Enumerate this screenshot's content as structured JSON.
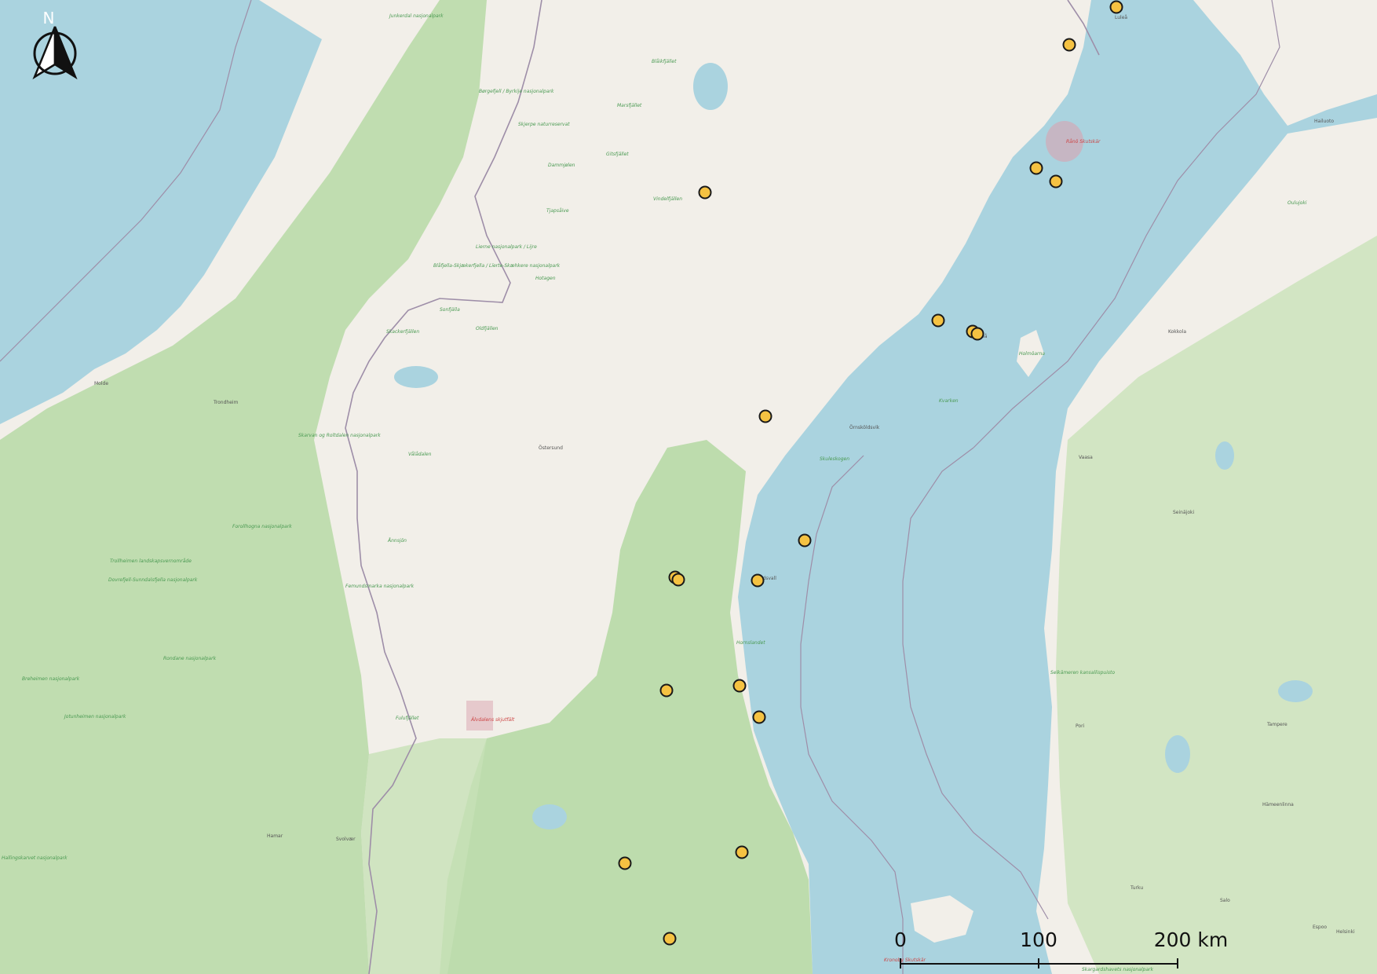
{
  "north_arrow": {
    "label": "N",
    "icon": "north-arrow-icon"
  },
  "scale_bar": {
    "ticks": [
      "0",
      "100",
      "200 km"
    ]
  },
  "colors": {
    "water": "#aad3df",
    "land": "#f2efe9",
    "park": "#b7d9a6",
    "marker": "#f5c242",
    "marker_stroke": "#1a1a1a",
    "border": "#9e8ea8"
  },
  "labels": {
    "parks": [
      "Junkerdal nasjonalpark",
      "Børgefjell / Byrkije nasjonalpark",
      "Skjerpe naturreservat",
      "Marsfjället",
      "Blåikfjället",
      "Dammjølen",
      "Vindelfjällen",
      "Tjapsåive",
      "Gitsfjället",
      "Lierne nasjonalpark / Lijre",
      "Blåfjella-Skjækerfjella / Lïerte-Skæhkere nasjonalpark",
      "Hotagen",
      "Sonfjälla",
      "Skackerfjällen",
      "Oldfjällen",
      "Vålådalen",
      "Skarvan og Roltdalen nasjonalpark",
      "Trollheimen landskapsvernområde",
      "Forollhogna nasjonalpark",
      "Femundsmarka nasjonalpark",
      "Dovrefjell-Sunndalsfjella nasjonalpark",
      "Rondane nasjonalpark",
      "Jotunheimen nasjonalpark",
      "Breheimen nasjonalpark",
      "Hallingskarvet nasjonalpark",
      "Fulufjället",
      "Ånnsjön",
      "Hornslandet",
      "Skuleskogen",
      "Holmöarna",
      "Kvarken",
      "Oulujoki",
      "Selkämeren kansallispuisto",
      "Skargardshavets nasjonalpark"
    ],
    "cities": [
      "Luleå",
      "Umeå",
      "Östersund",
      "Örnsköldsvik",
      "Trondheim",
      "Molde",
      "Vaasa",
      "Seinäjoki",
      "Pori",
      "Tampere",
      "Turku",
      "Helsinki",
      "Hämeenlinna",
      "Kokkola",
      "Hailuoto",
      "Sundsvall",
      "Hamar",
      "Svolvær",
      "Espoo",
      "Salo"
    ],
    "reserves": [
      "Rånö Skutskär",
      "Kronoby Skutskär",
      "Älvdalens skjutfält"
    ]
  },
  "markers": [
    {
      "id": 1,
      "label": ""
    },
    {
      "id": 2,
      "label": ""
    },
    {
      "id": 3,
      "label": ""
    },
    {
      "id": 4,
      "label": ""
    },
    {
      "id": 5,
      "label": ""
    },
    {
      "id": 6,
      "label": ""
    },
    {
      "id": 7,
      "label": ""
    },
    {
      "id": 8,
      "label": ""
    },
    {
      "id": 9,
      "label": ""
    },
    {
      "id": 10,
      "label": ""
    },
    {
      "id": 11,
      "label": ""
    },
    {
      "id": 12,
      "label": ""
    },
    {
      "id": 13,
      "label": ""
    },
    {
      "id": 14,
      "label": ""
    },
    {
      "id": 15,
      "label": ""
    },
    {
      "id": 16,
      "label": ""
    },
    {
      "id": 17,
      "label": ""
    },
    {
      "id": 18,
      "label": ""
    },
    {
      "id": 19,
      "label": ""
    },
    {
      "id": 20,
      "label": ""
    },
    {
      "id": 21,
      "label": ""
    },
    {
      "id": 22,
      "label": ""
    }
  ]
}
